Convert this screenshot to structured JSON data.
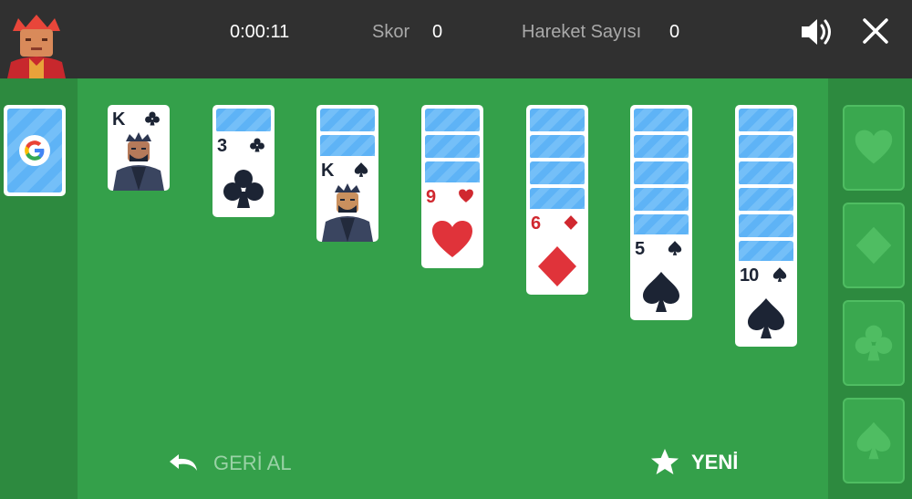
{
  "header": {
    "timer": "0:00:11",
    "score_label": "Skor",
    "score_value": "0",
    "moves_label": "Hareket Sayısı",
    "moves_value": "0",
    "sound_icon": "volume-icon",
    "close_icon": "close-icon"
  },
  "stock": {
    "logo_letter": "G"
  },
  "foundations": [
    {
      "suit": "heart"
    },
    {
      "suit": "diamond"
    },
    {
      "suit": "club"
    },
    {
      "suit": "spade"
    }
  ],
  "tableau": [
    {
      "face_down": 0,
      "top": {
        "rank": "K",
        "suit": "club"
      }
    },
    {
      "face_down": 1,
      "top": {
        "rank": "3",
        "suit": "club"
      }
    },
    {
      "face_down": 2,
      "top": {
        "rank": "K",
        "suit": "spade"
      }
    },
    {
      "face_down": 3,
      "top": {
        "rank": "9",
        "suit": "heart"
      }
    },
    {
      "face_down": 4,
      "top": {
        "rank": "6",
        "suit": "diamond"
      }
    },
    {
      "face_down": 5,
      "top": {
        "rank": "5",
        "suit": "spade"
      }
    },
    {
      "face_down": 6,
      "top": {
        "rank": "10",
        "suit": "spade"
      }
    }
  ],
  "controls": {
    "undo_label": "GERİ AL",
    "new_label": "YENİ"
  },
  "colors": {
    "felt": "#34a04a",
    "side_panel": "#2d8a3f",
    "topbar": "#303030",
    "red_suit": "#d0282f",
    "black_suit": "#1c2434"
  }
}
